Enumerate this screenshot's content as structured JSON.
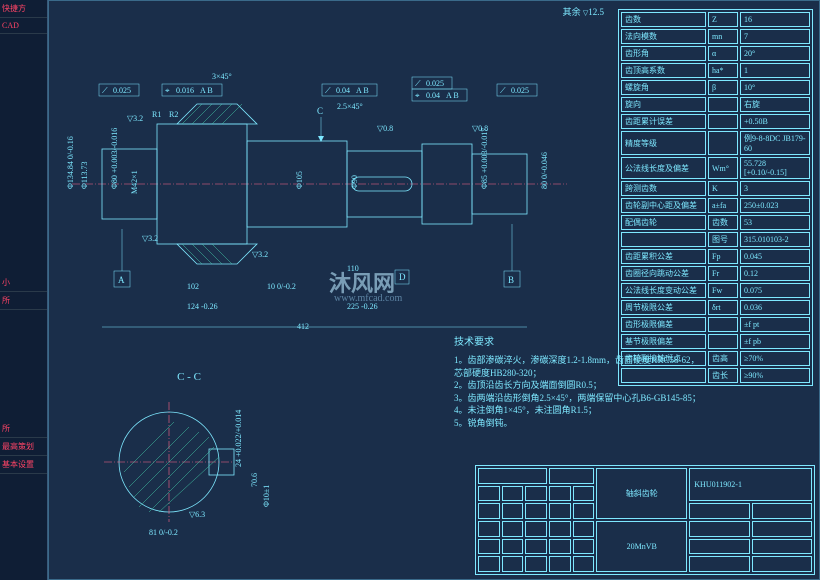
{
  "sidebar": {
    "tabs": [
      "快捷方",
      "CAD",
      "小",
      "所",
      "所",
      "最高策划",
      "基本设置"
    ]
  },
  "surface_finish": {
    "label": "其余",
    "value": "12.5"
  },
  "params": {
    "rows": [
      [
        "齿数",
        "Z",
        "16"
      ],
      [
        "法向模数",
        "mn",
        "7"
      ],
      [
        "齿形角",
        "α",
        "20°"
      ],
      [
        "齿顶高系数",
        "ha*",
        "1"
      ],
      [
        "螺旋角",
        "β",
        "10°"
      ],
      [
        "旋向",
        "",
        "右旋"
      ],
      [
        "齿距累计误差",
        "",
        "+0.50B"
      ],
      [
        "精度等级",
        "",
        "例9-8-8DC JB179-60"
      ],
      [
        "公法线长度及偏差",
        "Wm°",
        "55.728 [+0.10/-0.15]"
      ],
      [
        "跨测齿数",
        "K",
        "3"
      ],
      [
        "齿轮副中心距及偏差",
        "a±fa",
        "250±0.023"
      ],
      [
        "配偶齿轮",
        "齿数",
        "53"
      ],
      [
        "",
        "图号",
        "315.010103-2"
      ],
      [
        "齿距累积公差",
        "Fp",
        "0.045"
      ],
      [
        "齿圈径向跳动公差",
        "Fr",
        "0.12"
      ],
      [
        "公法线长度变动公差",
        "Fw",
        "0.075"
      ],
      [
        "周节极限公差",
        "δrt",
        "0.036"
      ],
      [
        "齿形极限偏差",
        "",
        "±f pt"
      ],
      [
        "基节极限偏差",
        "",
        "±f pb"
      ],
      [
        "齿轮副接触斑点",
        "齿高",
        "≥70%"
      ],
      [
        "",
        "齿长",
        "≥90%"
      ]
    ]
  },
  "dims": {
    "total": "412",
    "d1": "Φ134.84 0/-0.16",
    "d2": "Φ113.73",
    "d3": "Φ80 +0.003/-0.016",
    "d4": "Φ105",
    "d5": "Φ90",
    "d6": "Φ85 +0.003/-0.017",
    "d7": "80 0/-0.046",
    "l1": "102",
    "l2": "124 -0.26",
    "l3": "225 -0.26",
    "l4": "110",
    "l5": "10 0/-0.2",
    "key": "81 0/-0.2",
    "keyh": "70.6",
    "sect": "24 +0.022/+0.014",
    "hole": "Φ10±1",
    "chamf1": "3×45°",
    "chamf2": "2.5×45°",
    "r1": "R1",
    "r2": "R2",
    "ra1": "3.2",
    "ra2": "0.8",
    "ra3": "6.3",
    "thr": "M42×1",
    "tolr": "0.025",
    "tolp": "0.016",
    "tolr2": "0.04",
    "tol3": "0.04"
  },
  "tech_req": {
    "title": "技术要求",
    "items": [
      "1。齿部渗碳淬火，渗碳深度1.2-1.8mm，齿面硬度HRC58-62，芯部硬度HB280-320；",
      "2。齿顶沿齿长方向及端面倒圆R0.5；",
      "3。齿两端沿齿形倒角2.5×45°，两端保留中心孔B6-GB145-85；",
      "4。未注倒角1×45°，未注圆角R1.5；",
      "5。锐角倒钝。"
    ]
  },
  "title_block": {
    "name": "轴斜齿轮",
    "material": "20MnVB",
    "drawing_no": "KHU011902-1"
  },
  "section_label": "C - C",
  "datums": [
    "A",
    "B",
    "C",
    "D"
  ]
}
